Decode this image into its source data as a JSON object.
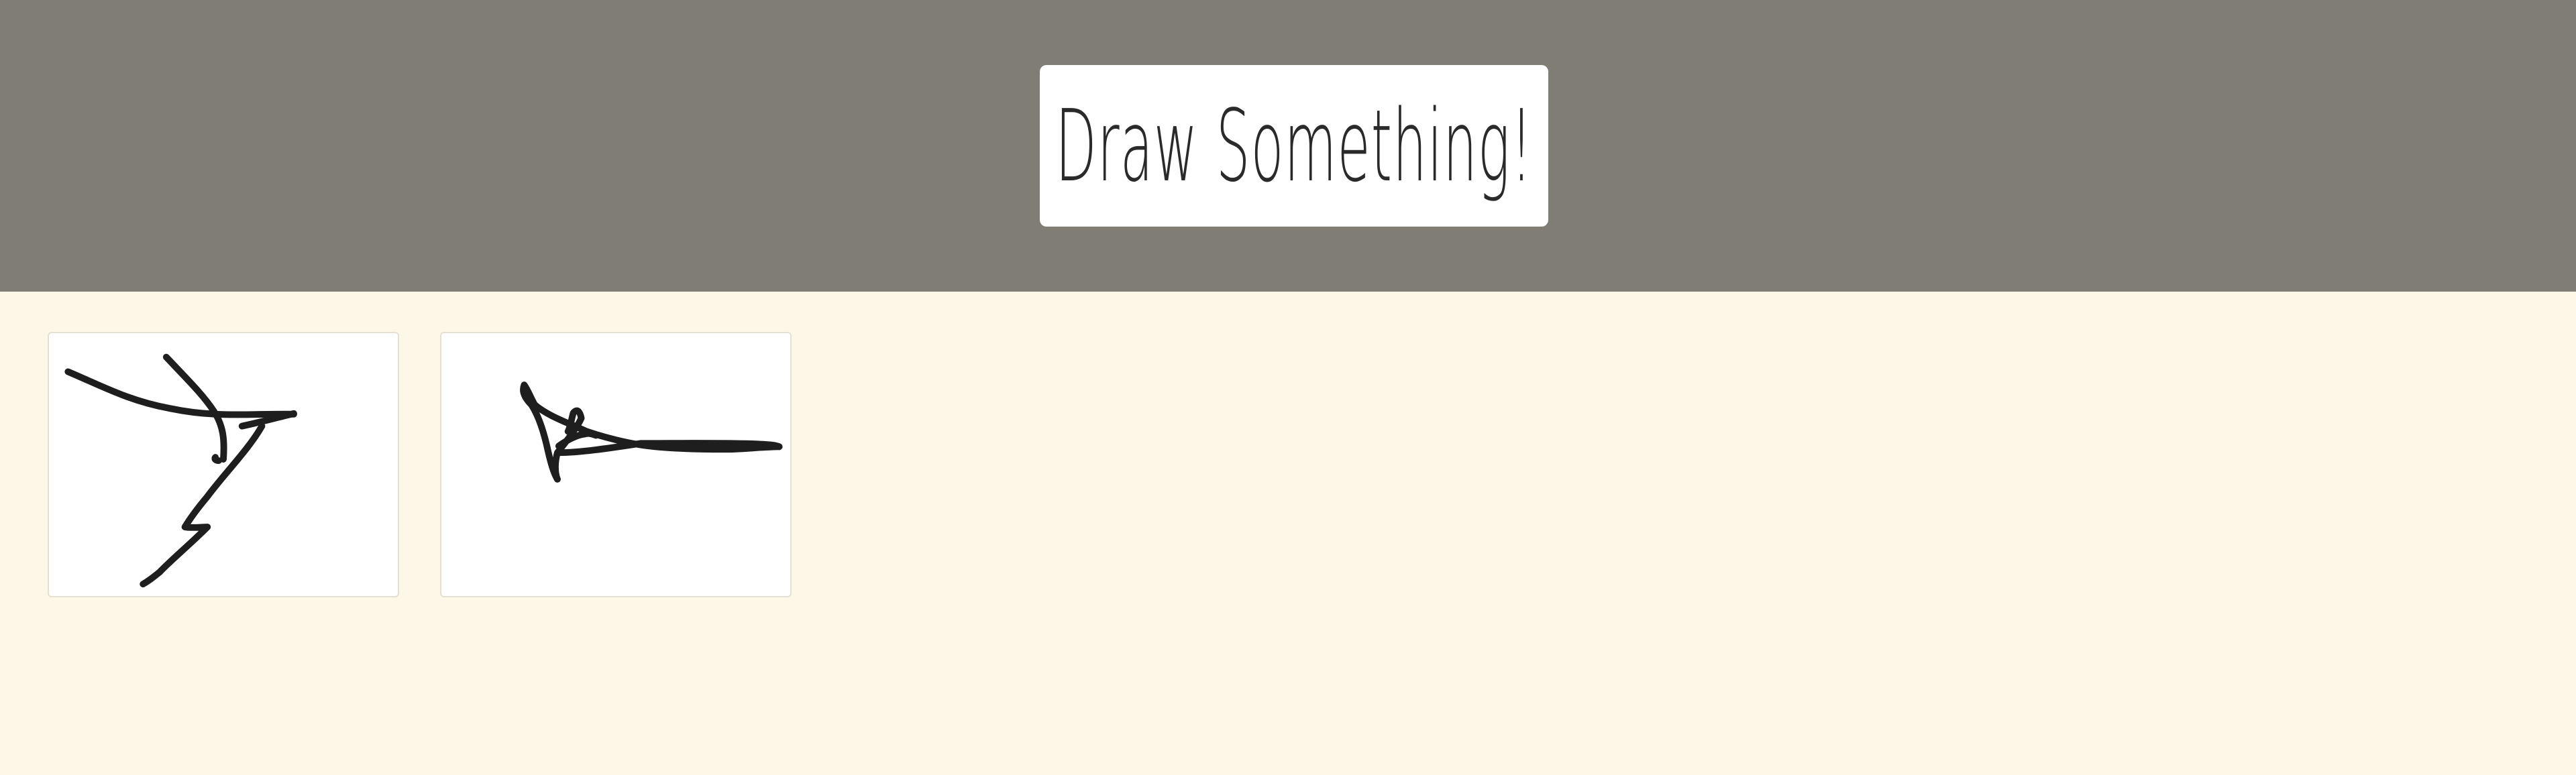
{
  "header": {
    "title": "Draw Something!",
    "background_color": "#807d74"
  },
  "gallery": {
    "background_color": "#fdf7e8",
    "drawings": [
      {
        "stroke_color": "#1e1e1e"
      },
      {
        "stroke_color": "#1e1e1e"
      }
    ]
  }
}
